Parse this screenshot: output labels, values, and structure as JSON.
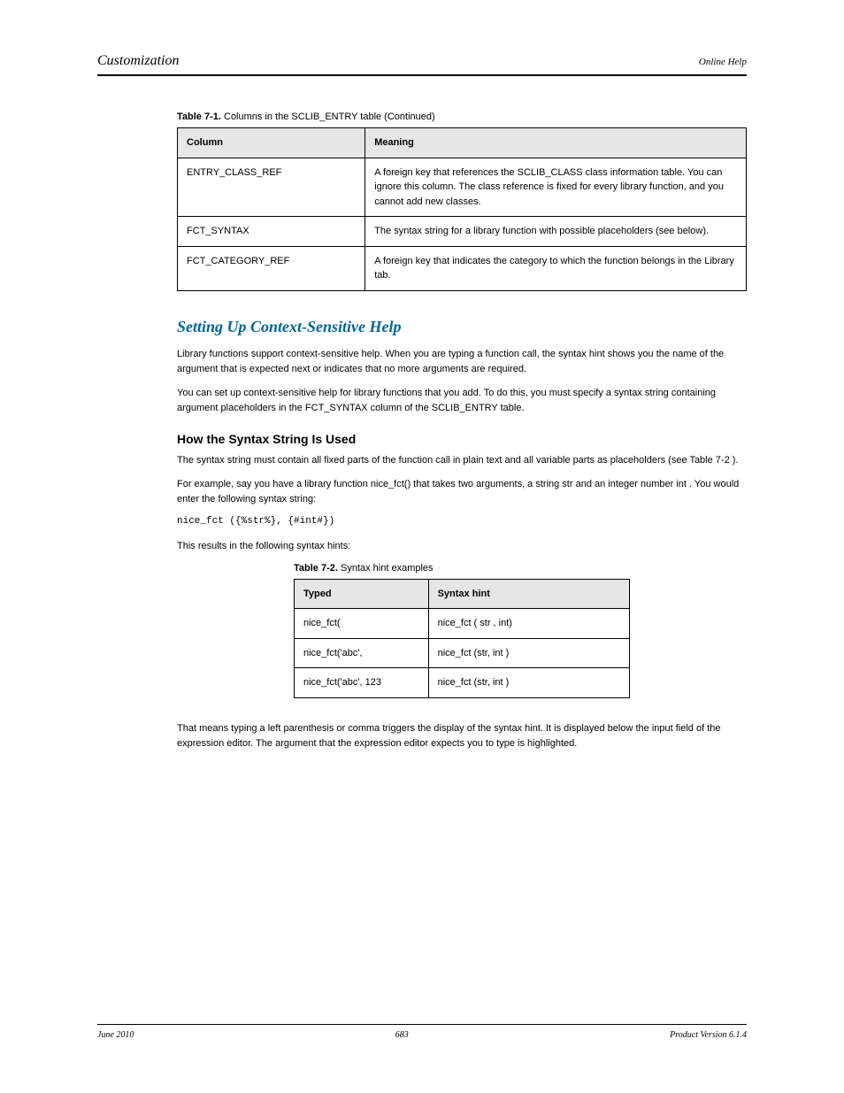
{
  "header": {
    "left": "Customization",
    "right": "Online Help"
  },
  "table1": {
    "caption_num": "Table 7-1.",
    "caption_text": "Columns in the SCLIB_ENTRY table (Continued)",
    "headers": [
      "Column",
      "Meaning"
    ],
    "rows": [
      {
        "c1": "ENTRY_CLASS_REF",
        "c2": "A foreign key that references the SCLIB_CLASS class information table. You can ignore this column. The class reference is fixed for every library function, and you cannot add new classes."
      },
      {
        "c1": "FCT_SYNTAX",
        "c2": "The syntax string for a library function with possible placeholders (see below)."
      },
      {
        "c1": "FCT_CATEGORY_REF",
        "c2": "A foreign key that indicates the category to which the function belongs in the Library tab."
      }
    ]
  },
  "section": {
    "title": "Setting Up Context-Sensitive Help",
    "para1": "Library functions support context-sensitive help. When you are typing a function call, the syntax hint shows you the name of the argument that is expected next or indicates that no more arguments are required.",
    "para2": "You can set up context-sensitive help for library functions that you add. To do this, you must specify a syntax string containing argument placeholders in the FCT_SYNTAX column of the SCLIB_ENTRY table.",
    "sub": "How the Syntax String Is Used",
    "para3": "The syntax string must contain all fixed parts of the function call in plain text and all variable parts as placeholders (see Table 7-2 ).",
    "para4": "For example, say you have a library function nice_fct() that takes two arguments, a string str and an integer number int . You would enter the following syntax string:",
    "syntax": "nice_fct ({%str%}, {#int#})",
    "para5": "This results in the following syntax hints:"
  },
  "table2": {
    "caption_num": "Table 7-2.",
    "caption_text": "Syntax hint examples",
    "headers": [
      "Typed",
      "Syntax hint"
    ],
    "rows": [
      {
        "c1": "nice_fct(",
        "c2": "nice_fct (  str  , int)"
      },
      {
        "c1": "nice_fct('abc',",
        "c2": "nice_fct (str,  int  )"
      },
      {
        "c1": "nice_fct('abc', 123",
        "c2": "nice_fct (str, int  )  "
      }
    ]
  },
  "closing": "That means typing a left parenthesis or comma triggers the display of the syntax hint. It is displayed below the input field of the expression editor. The argument that the expression editor expects you to type is highlighted.",
  "footer": {
    "left": "June 2010",
    "center": "683",
    "right": "Product Version 6.1.4"
  }
}
